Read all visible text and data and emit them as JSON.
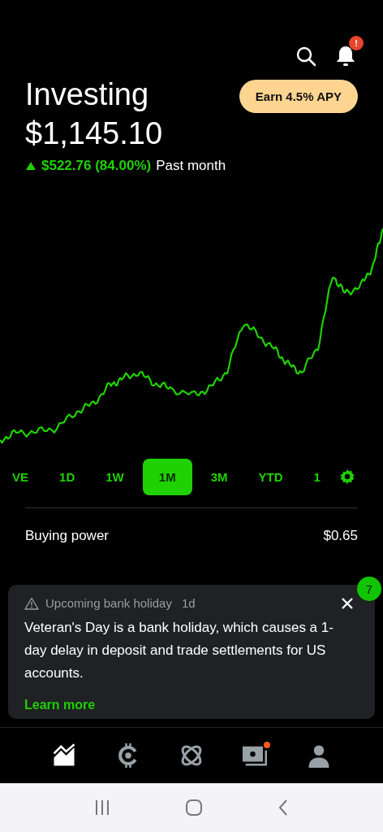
{
  "header": {
    "notification_badge": "!",
    "title": "Investing",
    "promo_button": "Earn 4.5% APY",
    "portfolio_value": "$1,145.10",
    "change": "$522.76 (84.00%)",
    "period": "Past month"
  },
  "ranges": [
    {
      "label": "VE",
      "selected": false
    },
    {
      "label": "1D",
      "selected": false
    },
    {
      "label": "1W",
      "selected": false
    },
    {
      "label": "1M",
      "selected": true
    },
    {
      "label": "3M",
      "selected": false
    },
    {
      "label": "YTD",
      "selected": false
    },
    {
      "label": "1",
      "selected": false
    }
  ],
  "buying_power": {
    "label": "Buying power",
    "value": "$0.65"
  },
  "notice": {
    "title": "Upcoming bank holiday",
    "age": "1d",
    "count": "7",
    "body": "Veteran's Day is a bank holiday, which causes a 1-day delay in deposit and trade settlements for US accounts.",
    "link": "Learn more"
  },
  "nav": [
    {
      "kind": "investing",
      "selected": true,
      "badge": false
    },
    {
      "kind": "crypto",
      "selected": false,
      "badge": false
    },
    {
      "kind": "orbit",
      "selected": false,
      "badge": false
    },
    {
      "kind": "money",
      "selected": false,
      "badge": true
    },
    {
      "kind": "account",
      "selected": false,
      "badge": false
    }
  ]
}
